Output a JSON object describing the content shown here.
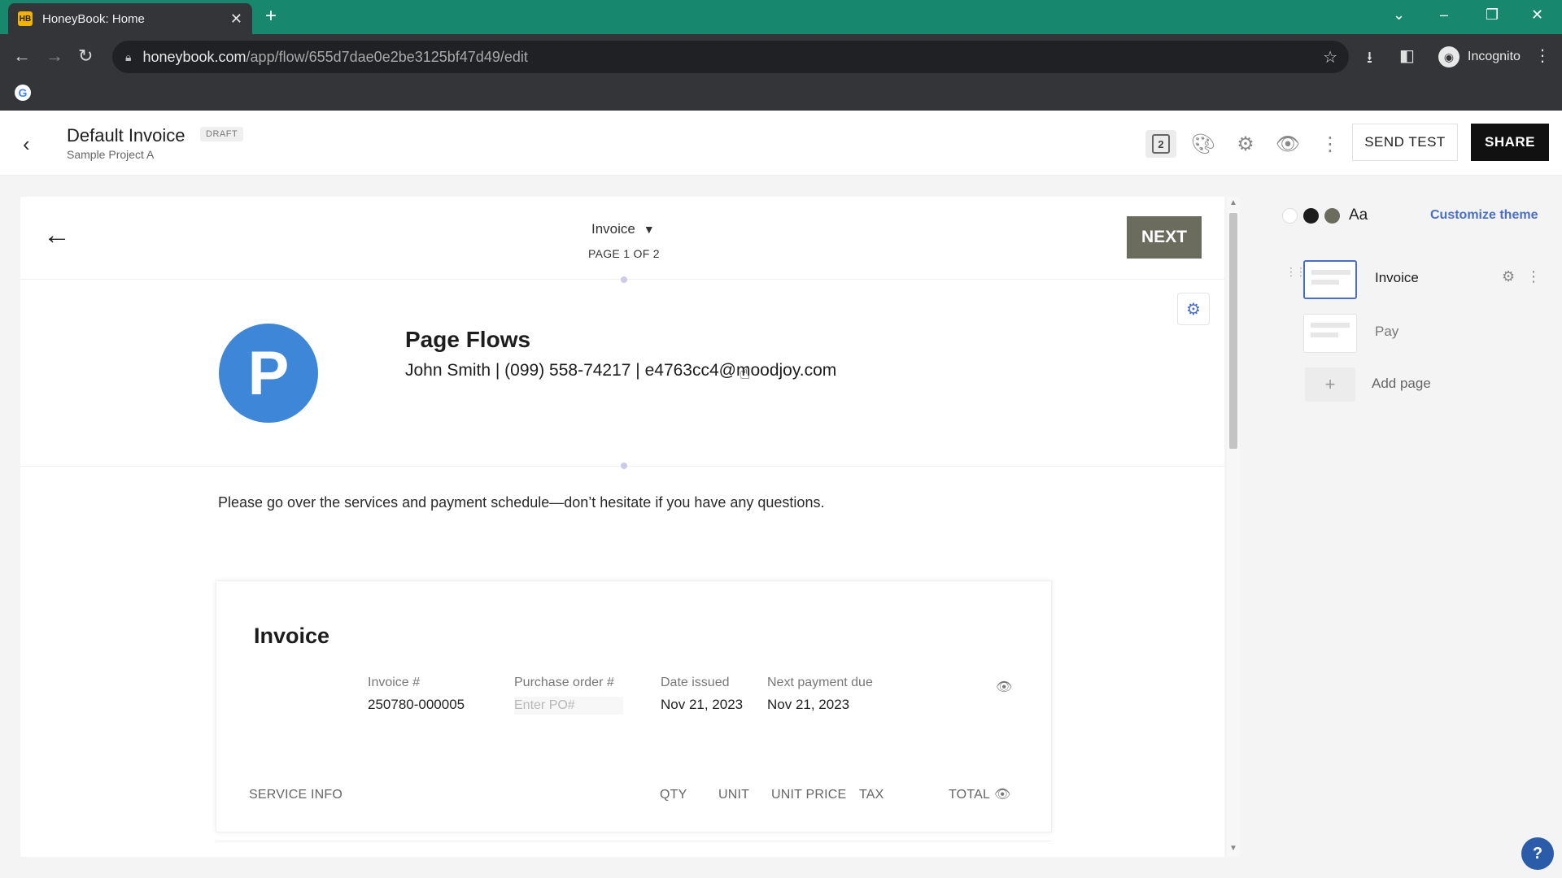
{
  "browser": {
    "tab_title": "HoneyBook: Home",
    "tab_favicon": "HB",
    "url_host": "honeybook.com",
    "url_path": "/app/flow/655d7dae0e2be3125bf47d49/edit",
    "incognito_label": "Incognito"
  },
  "header": {
    "doc_title": "Default Invoice",
    "status_badge": "DRAFT",
    "project_name": "Sample Project A",
    "pages_count": "2",
    "send_test_label": "SEND TEST",
    "share_label": "SHARE"
  },
  "canvas": {
    "page_selector": "Invoice",
    "page_indicator": "PAGE 1 OF 2",
    "next_label": "NEXT",
    "logo_letter": "P",
    "company_name": "Page Flows",
    "company_info": "John Smith | (099) 558-74217 | e4763cc4@moodjoy.com",
    "intro_text": "Please go over the services and payment schedule—don’t hesitate if you have any questions."
  },
  "invoice": {
    "title": "Invoice",
    "meta": [
      {
        "label": "Invoice #",
        "value": "250780-000005"
      },
      {
        "label": "Purchase order #",
        "placeholder": "Enter PO#"
      },
      {
        "label": "Date issued",
        "value": "Nov 21, 2023"
      },
      {
        "label": "Next payment due",
        "value": "Nov 21, 2023"
      }
    ],
    "columns": [
      "SERVICE INFO",
      "QTY",
      "UNIT",
      "UNIT PRICE",
      "TAX",
      "TOTAL"
    ]
  },
  "panel": {
    "theme_font_label": "Aa",
    "customize_label": "Customize theme",
    "pages": [
      {
        "label": "Invoice"
      },
      {
        "label": "Pay"
      }
    ],
    "add_page_label": "Add page",
    "swatch_colors": [
      "#ffffff",
      "#1d1d1d",
      "#6b6b5e"
    ]
  },
  "help_label": "?"
}
